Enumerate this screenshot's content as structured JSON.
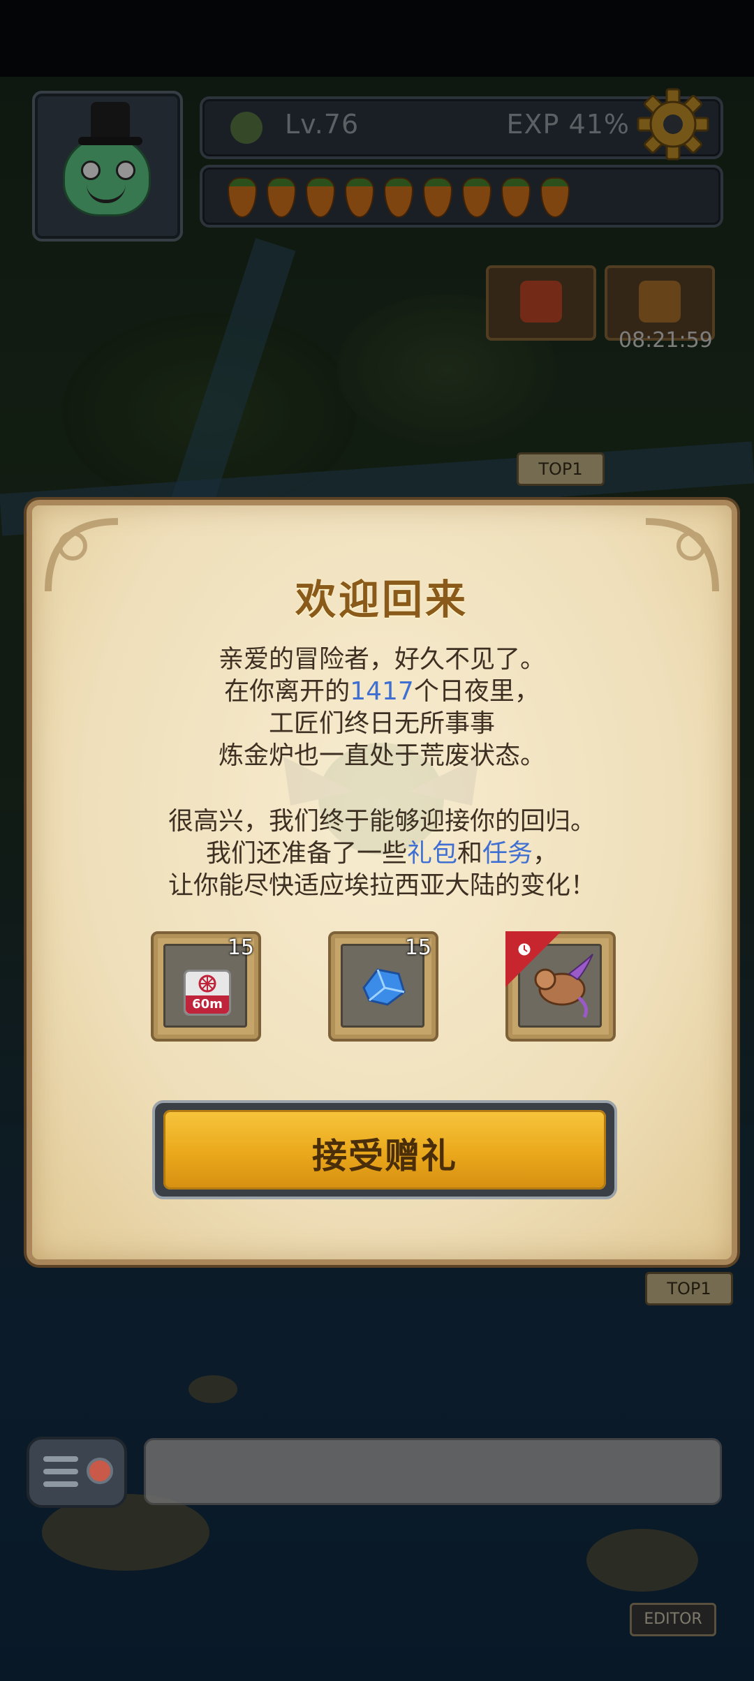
{
  "hud": {
    "level": "Lv.76",
    "exp": "EXP 41%",
    "carrot_count": 9,
    "timer": "08:21:59"
  },
  "map_badges": {
    "top1_a": "TOP1",
    "top1_b": "TOP1",
    "editor": "EDITOR"
  },
  "dialog": {
    "title": "欢迎回来",
    "lines1": [
      "亲爱的冒险者，好久不见了。",
      "在你离开的",
      "1417",
      "个日夜里，",
      "工匠们终日无所事事",
      "炼金炉也一直处于荒废状态。"
    ],
    "lines2": [
      "很高兴，我们终于能够迎接你的回归。",
      "我们还准备了一些",
      "礼包",
      "和",
      "任务",
      "，",
      "让你能尽快适应埃拉西亚大陆的变化！"
    ],
    "rewards": [
      {
        "icon": "speedup-60m-icon",
        "label": "60m",
        "qty": "15"
      },
      {
        "icon": "blue-crystal-icon",
        "qty": "15"
      },
      {
        "icon": "dragon-pet-icon",
        "qty": ""
      }
    ],
    "accept_label": "接受赠礼"
  },
  "colors": {
    "highlight": "#3f6fd2",
    "title": "#8a5a1a",
    "button": "#eaa81c"
  }
}
